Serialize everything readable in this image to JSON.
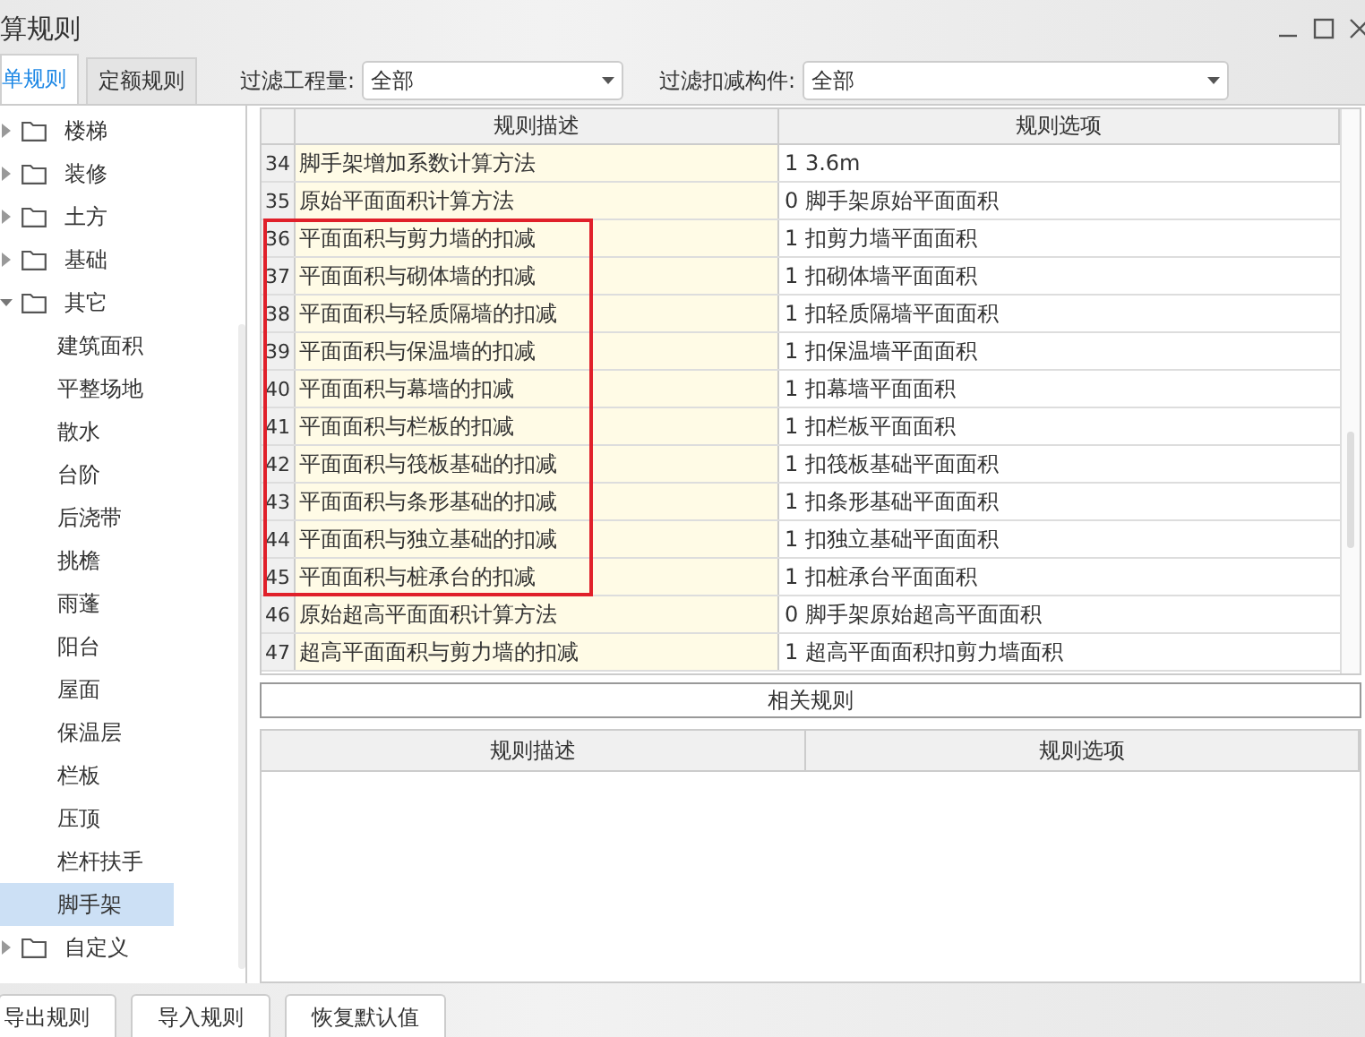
{
  "window": {
    "title": "算规则"
  },
  "tabs": [
    {
      "label": "单规则",
      "selected": true
    },
    {
      "label": "定额规则",
      "selected": false
    }
  ],
  "filters": [
    {
      "label": "过滤工程量:",
      "value": "全部"
    },
    {
      "label": "过滤扣减构件:",
      "value": "全部"
    }
  ],
  "tree": [
    {
      "label": "楼梯",
      "expanded": false,
      "selected": false
    },
    {
      "label": "装修",
      "expanded": false,
      "selected": false
    },
    {
      "label": "土方",
      "expanded": false,
      "selected": false
    },
    {
      "label": "基础",
      "expanded": false,
      "selected": false
    },
    {
      "label": "其它",
      "expanded": true,
      "selected": false,
      "children": [
        {
          "label": "建筑面积",
          "selected": false
        },
        {
          "label": "平整场地",
          "selected": false
        },
        {
          "label": "散水",
          "selected": false
        },
        {
          "label": "台阶",
          "selected": false
        },
        {
          "label": "后浇带",
          "selected": false
        },
        {
          "label": "挑檐",
          "selected": false
        },
        {
          "label": "雨蓬",
          "selected": false
        },
        {
          "label": "阳台",
          "selected": false
        },
        {
          "label": "屋面",
          "selected": false
        },
        {
          "label": "保温层",
          "selected": false
        },
        {
          "label": "栏板",
          "selected": false
        },
        {
          "label": "压顶",
          "selected": false
        },
        {
          "label": "栏杆扶手",
          "selected": false
        },
        {
          "label": "脚手架",
          "selected": true
        }
      ]
    },
    {
      "label": "自定义",
      "expanded": false,
      "selected": false
    }
  ],
  "rules_table": {
    "columns": [
      "规则描述",
      "规则选项"
    ],
    "rows": [
      {
        "number": "34",
        "description": "脚手架增加系数计算方法",
        "option": "1 3.6m",
        "marked": false
      },
      {
        "number": "35",
        "description": "原始平面面积计算方法",
        "option": "0 脚手架原始平面面积",
        "marked": false
      },
      {
        "number": "36",
        "description": "平面面积与剪力墙的扣减",
        "option": "1 扣剪力墙平面面积",
        "marked": true
      },
      {
        "number": "37",
        "description": "平面面积与砌体墙的扣减",
        "option": "1 扣砌体墙平面面积",
        "marked": true
      },
      {
        "number": "38",
        "description": "平面面积与轻质隔墙的扣减",
        "option": "1 扣轻质隔墙平面面积",
        "marked": true
      },
      {
        "number": "39",
        "description": "平面面积与保温墙的扣减",
        "option": "1 扣保温墙平面面积",
        "marked": true
      },
      {
        "number": "40",
        "description": "平面面积与幕墙的扣减",
        "option": "1 扣幕墙平面面积",
        "marked": true
      },
      {
        "number": "41",
        "description": "平面面积与栏板的扣减",
        "option": "1 扣栏板平面面积",
        "marked": true
      },
      {
        "number": "42",
        "description": "平面面积与筏板基础的扣减",
        "option": "1 扣筏板基础平面面积",
        "marked": true
      },
      {
        "number": "43",
        "description": "平面面积与条形基础的扣减",
        "option": "1 扣条形基础平面面积",
        "marked": true
      },
      {
        "number": "44",
        "description": "平面面积与独立基础的扣减",
        "option": "1 扣独立基础平面面积",
        "marked": true
      },
      {
        "number": "45",
        "description": "平面面积与桩承台的扣减",
        "option": "1 扣桩承台平面面积",
        "marked": true
      },
      {
        "number": "46",
        "description": "原始超高平面面积计算方法",
        "option": "0 脚手架原始超高平面面积",
        "marked": false
      },
      {
        "number": "47",
        "description": "超高平面面积与剪力墙的扣减",
        "option": "1 超高平面面积扣剪力墙面积",
        "marked": false
      }
    ]
  },
  "related": {
    "title": "相关规则",
    "columns": [
      "规则描述",
      "规则选项"
    ]
  },
  "buttons": [
    "导出规则",
    "导入规则",
    "恢复默认值"
  ]
}
